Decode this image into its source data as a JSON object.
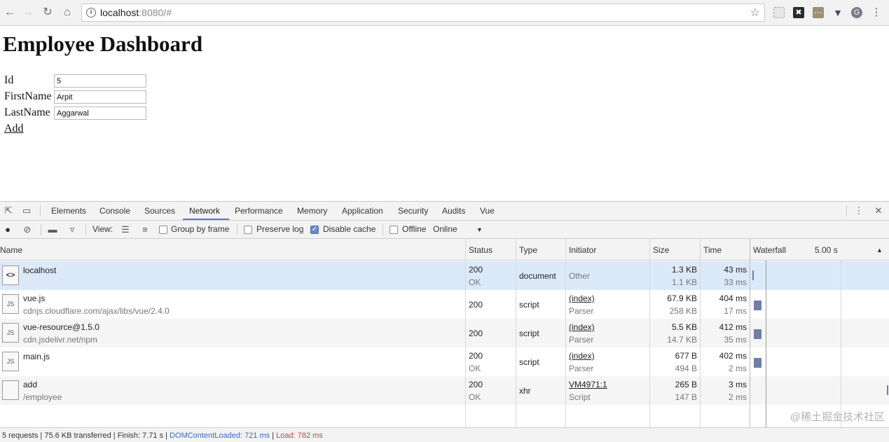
{
  "browser": {
    "url_host": "localhost",
    "url_rest": ":8080/#"
  },
  "page": {
    "title": "Employee Dashboard",
    "form": {
      "id_label": "Id",
      "id_value": "5",
      "firstname_label": "FirstName",
      "firstname_value": "Arpit",
      "lastname_label": "LastName",
      "lastname_value": "Aggarwal",
      "add_label": "Add"
    }
  },
  "devtools": {
    "tabs": [
      "Elements",
      "Console",
      "Sources",
      "Network",
      "Performance",
      "Memory",
      "Application",
      "Security",
      "Audits",
      "Vue"
    ],
    "active_tab": "Network",
    "toolbar": {
      "view_label": "View:",
      "group_by_frame": "Group by frame",
      "preserve_log": "Preserve log",
      "disable_cache": "Disable cache",
      "offline": "Offline",
      "throttle": "Online"
    },
    "columns": {
      "name": "Name",
      "status": "Status",
      "type": "Type",
      "initiator": "Initiator",
      "size": "Size",
      "time": "Time",
      "waterfall": "Waterfall",
      "waterfall_time": "5.00 s"
    },
    "rows": [
      {
        "name": "localhost",
        "path": "",
        "status": "200",
        "status_text": "OK",
        "type": "document",
        "initiator": "Other",
        "initiator_sub": "",
        "size": "1.3 KB",
        "size_sub": "1.1 KB",
        "time": "43 ms",
        "time_sub": "33 ms",
        "icon": "document-icon"
      },
      {
        "name": "vue.js",
        "path": "cdnjs.cloudflare.com/ajax/libs/vue/2.4.0",
        "status": "200",
        "status_text": "",
        "type": "script",
        "initiator": "(index)",
        "initiator_sub": "Parser",
        "size": "67.9 KB",
        "size_sub": "258 KB",
        "time": "404 ms",
        "time_sub": "17 ms",
        "icon": "script-icon"
      },
      {
        "name": "vue-resource@1.5.0",
        "path": "cdn.jsdelivr.net/npm",
        "status": "200",
        "status_text": "",
        "type": "script",
        "initiator": "(index)",
        "initiator_sub": "Parser",
        "size": "5.5 KB",
        "size_sub": "14.7 KB",
        "time": "412 ms",
        "time_sub": "35 ms",
        "icon": "script-icon"
      },
      {
        "name": "main.js",
        "path": "",
        "status": "200",
        "status_text": "OK",
        "type": "script",
        "initiator": "(index)",
        "initiator_sub": "Parser",
        "size": "677 B",
        "size_sub": "494 B",
        "time": "402 ms",
        "time_sub": "2 ms",
        "icon": "script-icon"
      },
      {
        "name": "add",
        "path": "/employee",
        "status": "200",
        "status_text": "OK",
        "type": "xhr",
        "initiator": "VM4971:1",
        "initiator_sub": "Script",
        "size": "265 B",
        "size_sub": "147 B",
        "time": "3 ms",
        "time_sub": "2 ms",
        "icon": "blank-file-icon"
      }
    ],
    "status_bar": {
      "summary": "5 requests | 75.6 KB transferred | Finish: 7.71 s | ",
      "dom_content_loaded": "DOMContentLoaded: 721 ms",
      "sep": " | ",
      "load": "Load: 782 ms"
    }
  },
  "watermark": "@稀土掘金技术社区"
}
